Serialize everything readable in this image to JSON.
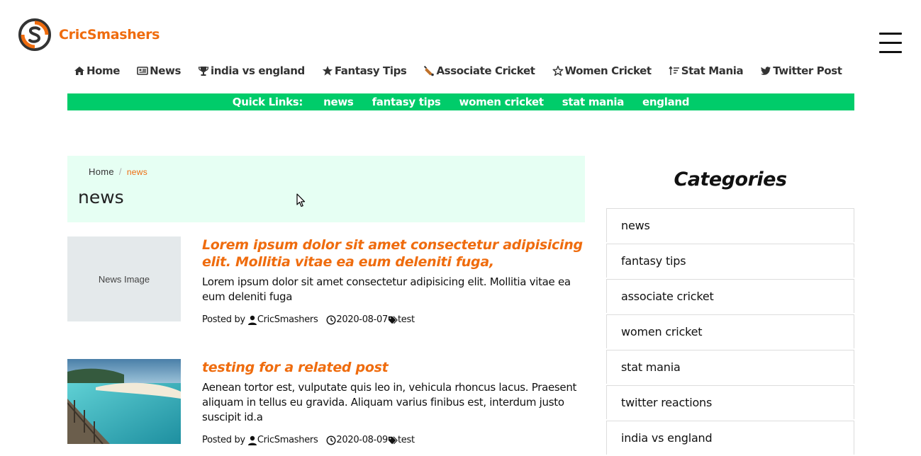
{
  "brand": {
    "name": "CricSmashers",
    "accent": "#ef6c0e",
    "green": "#00cc6a"
  },
  "nav": [
    {
      "label": "Home",
      "icon": "home-icon"
    },
    {
      "label": "News",
      "icon": "newspaper-icon"
    },
    {
      "label": "india vs england",
      "icon": "trophy-icon"
    },
    {
      "label": "Fantasy Tips",
      "icon": "star-icon"
    },
    {
      "label": "Associate Cricket",
      "icon": "cricket-bat-icon"
    },
    {
      "label": "Women Cricket",
      "icon": "star-outline-icon"
    },
    {
      "label": "Stat Mania",
      "icon": "sort-icon"
    },
    {
      "label": "Twitter Post",
      "icon": "twitter-icon"
    }
  ],
  "quick_links": {
    "label": "Quick Links:",
    "items": [
      "news",
      "fantasy tips",
      "women cricket",
      "stat mania",
      "england"
    ]
  },
  "breadcrumb": {
    "home": "Home",
    "sep": "/",
    "current": "news"
  },
  "page_title": "news",
  "posts": [
    {
      "thumb_text": "News Image",
      "title": "Lorem ipsum dolor sit amet consectetur adipisicing elit. Mollitia vitae ea eum deleniti fuga,",
      "excerpt": "Lorem ipsum dolor sit amet consectetur adipisicing elit. Mollitia vitae ea eum deleniti fuga",
      "posted_by_label": "Posted by",
      "author": "CricSmashers",
      "date": "2020-08-07",
      "tag": "test"
    },
    {
      "thumb_text": "",
      "title": "testing for a related post",
      "excerpt": "Aenean tortor est, vulputate quis leo in, vehicula rhoncus lacus. Praesent aliquam in tellus eu gravida. Aliquam varius finibus est, interdum justo suscipit id.a",
      "posted_by_label": "Posted by",
      "author": "CricSmashers",
      "date": "2020-08-09",
      "tag": "test"
    }
  ],
  "categories": {
    "title": "Categories",
    "items": [
      "news",
      "fantasy tips",
      "associate cricket",
      "women cricket",
      "stat mania",
      "twitter reactions",
      "india vs england"
    ]
  }
}
